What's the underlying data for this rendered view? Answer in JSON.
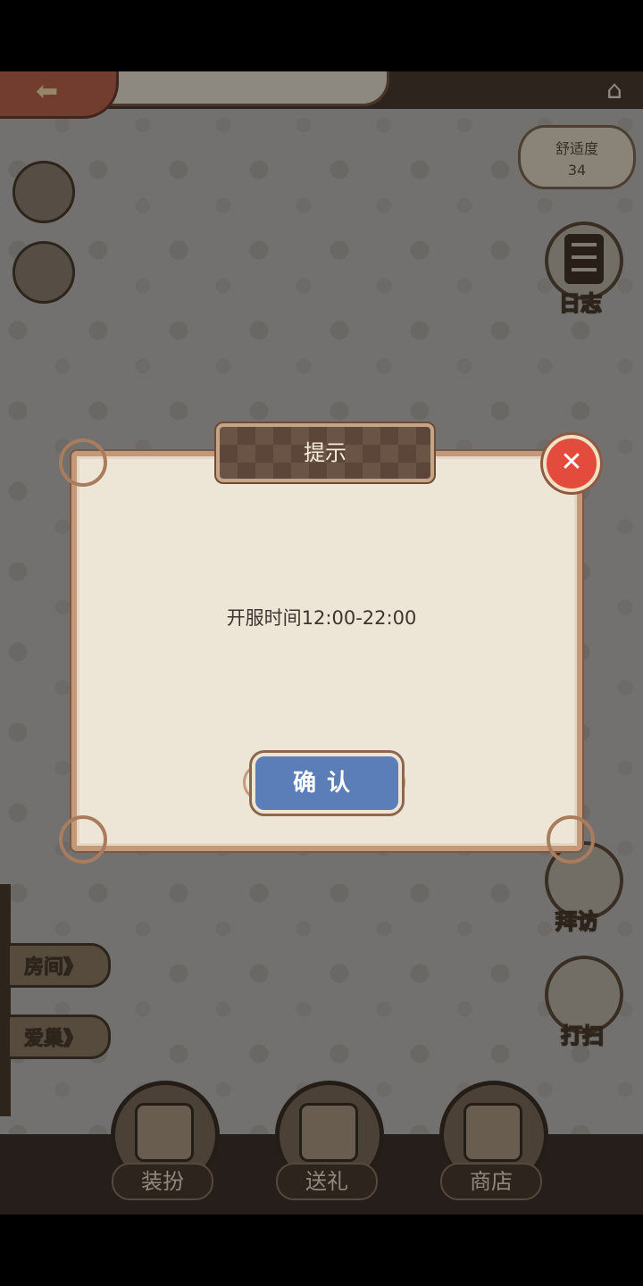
{
  "topbar": {
    "back_icon": "arrow-left-icon",
    "home_icon": "home-icon"
  },
  "comfort": {
    "label": "舒适度",
    "value": "34"
  },
  "right_menu": {
    "journal": "日志",
    "visit": "拜访",
    "clean": "打扫"
  },
  "signs": {
    "room": "房间》",
    "nest": "爱巢》"
  },
  "bottom_nav": {
    "dress": "装扮",
    "gift": "送礼",
    "shop": "商店"
  },
  "dialog": {
    "title": "提示",
    "message": "开服时间12:00-22:00",
    "confirm": "确认",
    "close": "✕"
  },
  "colors": {
    "confirm_blue": "#5b7db8",
    "close_red": "#e34b3c",
    "dialog_bg": "#ede6d6"
  }
}
